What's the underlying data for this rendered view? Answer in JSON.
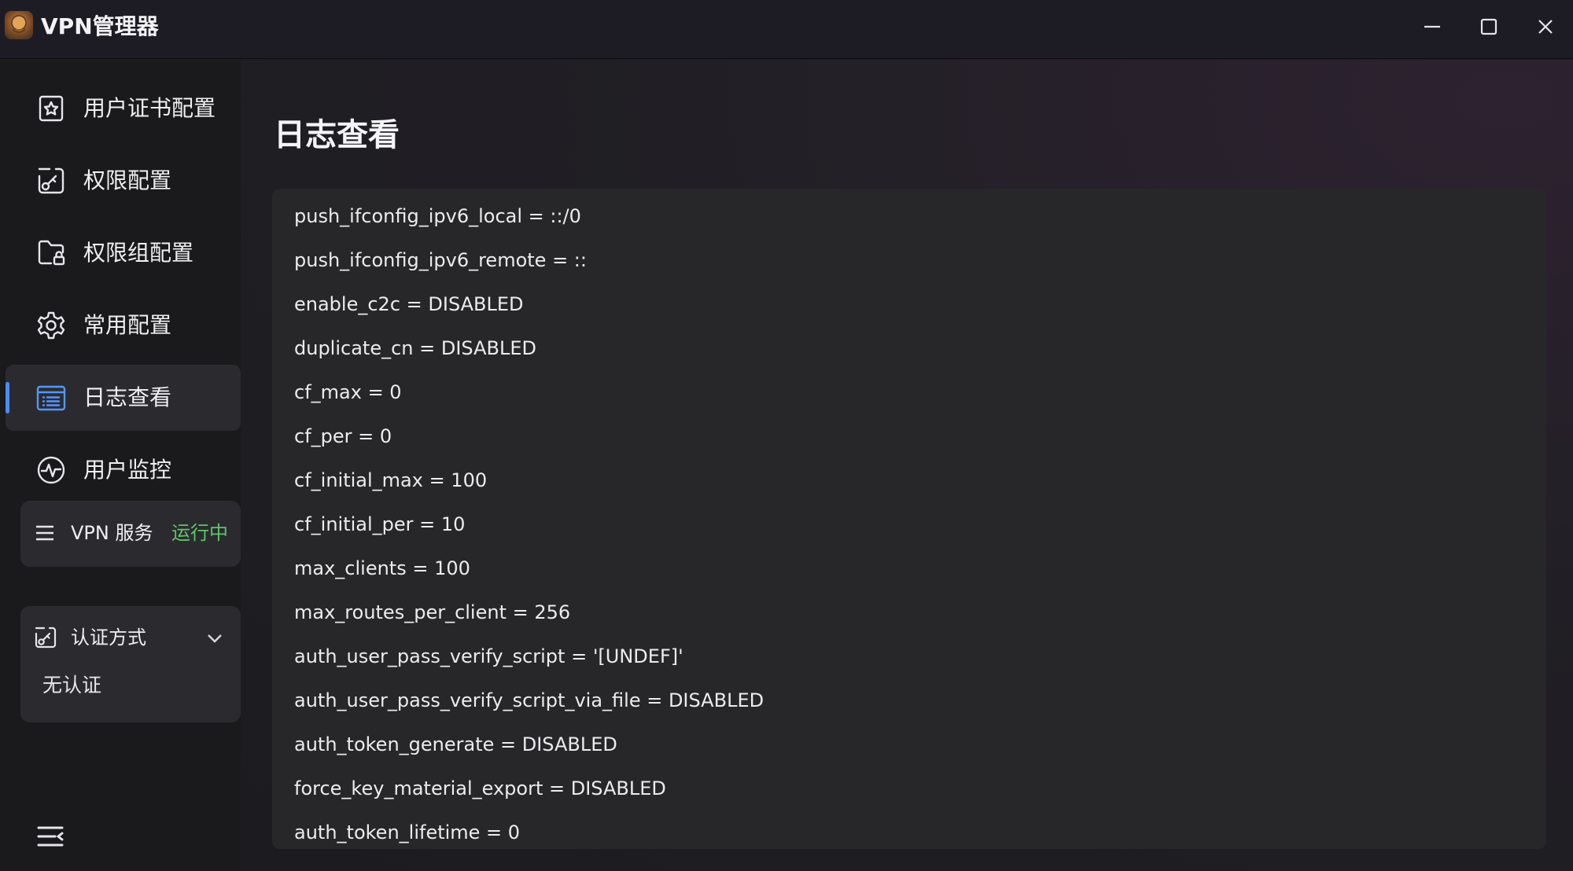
{
  "window": {
    "title": "VPN管理器",
    "logo_text": "VPN"
  },
  "sidebar": {
    "items": [
      {
        "label": "用户证书配置",
        "icon": "certificate-icon",
        "active": false
      },
      {
        "label": "权限配置",
        "icon": "permission-icon",
        "active": false
      },
      {
        "label": "权限组配置",
        "icon": "folder-lock-icon",
        "active": false
      },
      {
        "label": "常用配置",
        "icon": "gear-icon",
        "active": false
      },
      {
        "label": "日志查看",
        "icon": "log-list-icon",
        "active": true
      },
      {
        "label": "用户监控",
        "icon": "pulse-icon",
        "active": false
      }
    ],
    "vpn_service": {
      "label": "VPN 服务",
      "status": "运行中",
      "status_color": "#5fc46a"
    },
    "auth": {
      "label": "认证方式",
      "value": "无认证"
    }
  },
  "main": {
    "title": "日志查看",
    "log_lines": [
      "push_ifconfig_ipv6_local = ::/0",
      "push_ifconfig_ipv6_remote = ::",
      "enable_c2c = DISABLED",
      "duplicate_cn = DISABLED",
      "cf_max = 0",
      "cf_per = 0",
      "cf_initial_max = 100",
      "cf_initial_per = 10",
      "max_clients = 100",
      "max_routes_per_client = 256",
      "auth_user_pass_verify_script = '[UNDEF]'",
      "auth_user_pass_verify_script_via_file = DISABLED",
      "auth_token_generate = DISABLED",
      "force_key_material_export = DISABLED",
      "auth_token_lifetime = 0"
    ]
  },
  "colors": {
    "accent": "#4a8cff",
    "status_running": "#5fc46a"
  }
}
